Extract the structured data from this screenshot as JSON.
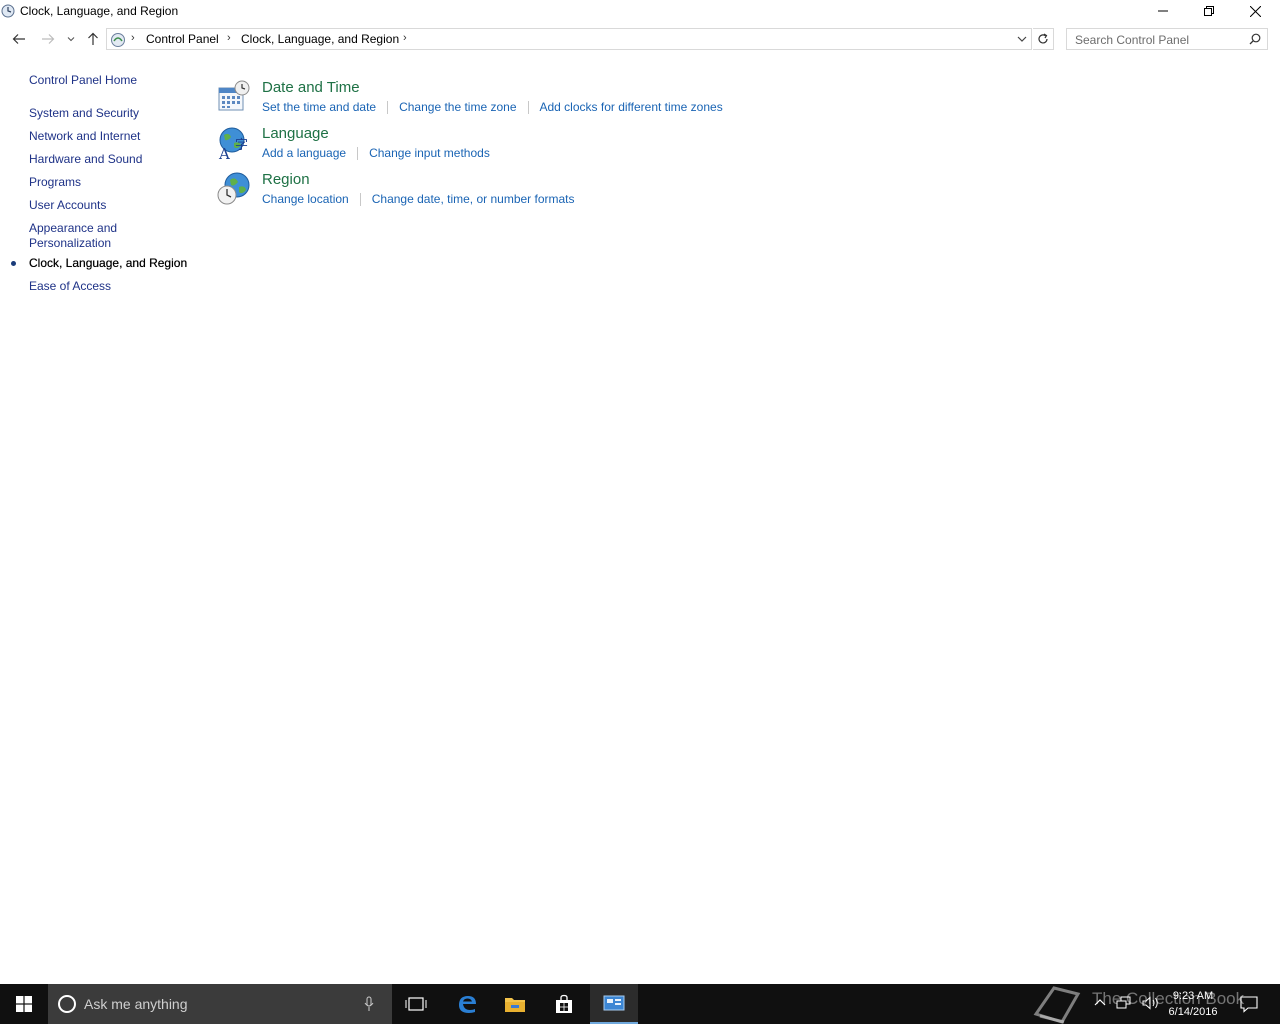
{
  "window": {
    "title": "Clock, Language, and Region",
    "controls": {
      "minimize": "minimize-icon",
      "maximize": "restore-icon",
      "close": "close-icon"
    }
  },
  "navigation": {
    "breadcrumb": [
      "Control Panel",
      "Clock, Language, and Region"
    ],
    "search_placeholder": "Search Control Panel"
  },
  "sidebar": {
    "home": "Control Panel Home",
    "items": [
      {
        "label": "System and Security",
        "current": false
      },
      {
        "label": "Network and Internet",
        "current": false
      },
      {
        "label": "Hardware and Sound",
        "current": false
      },
      {
        "label": "Programs",
        "current": false
      },
      {
        "label": "User Accounts",
        "current": false
      },
      {
        "label": "Appearance and",
        "label2": "Personalization",
        "current": false
      },
      {
        "label": "Clock, Language, and Region",
        "current": true
      },
      {
        "label": "Ease of Access",
        "current": false
      }
    ]
  },
  "sections": [
    {
      "title": "Date and Time",
      "icon": "calendar-clock-icon",
      "links": [
        "Set the time and date",
        "Change the time zone",
        "Add clocks for different time zones"
      ]
    },
    {
      "title": "Language",
      "icon": "language-globe-icon",
      "links": [
        "Add a language",
        "Change input methods"
      ]
    },
    {
      "title": "Region",
      "icon": "region-globe-clock-icon",
      "links": [
        "Change location",
        "Change date, time, or number formats"
      ]
    }
  ],
  "taskbar": {
    "search_text": "Ask me anything",
    "time": "9:23 AM",
    "date": "6/14/2016",
    "watermark": "The Collection Book",
    "accent": "#6fa8dc"
  },
  "colors": {
    "link": "#1a64b4",
    "section_title": "#1e7145",
    "nav_link": "#1e3287"
  }
}
